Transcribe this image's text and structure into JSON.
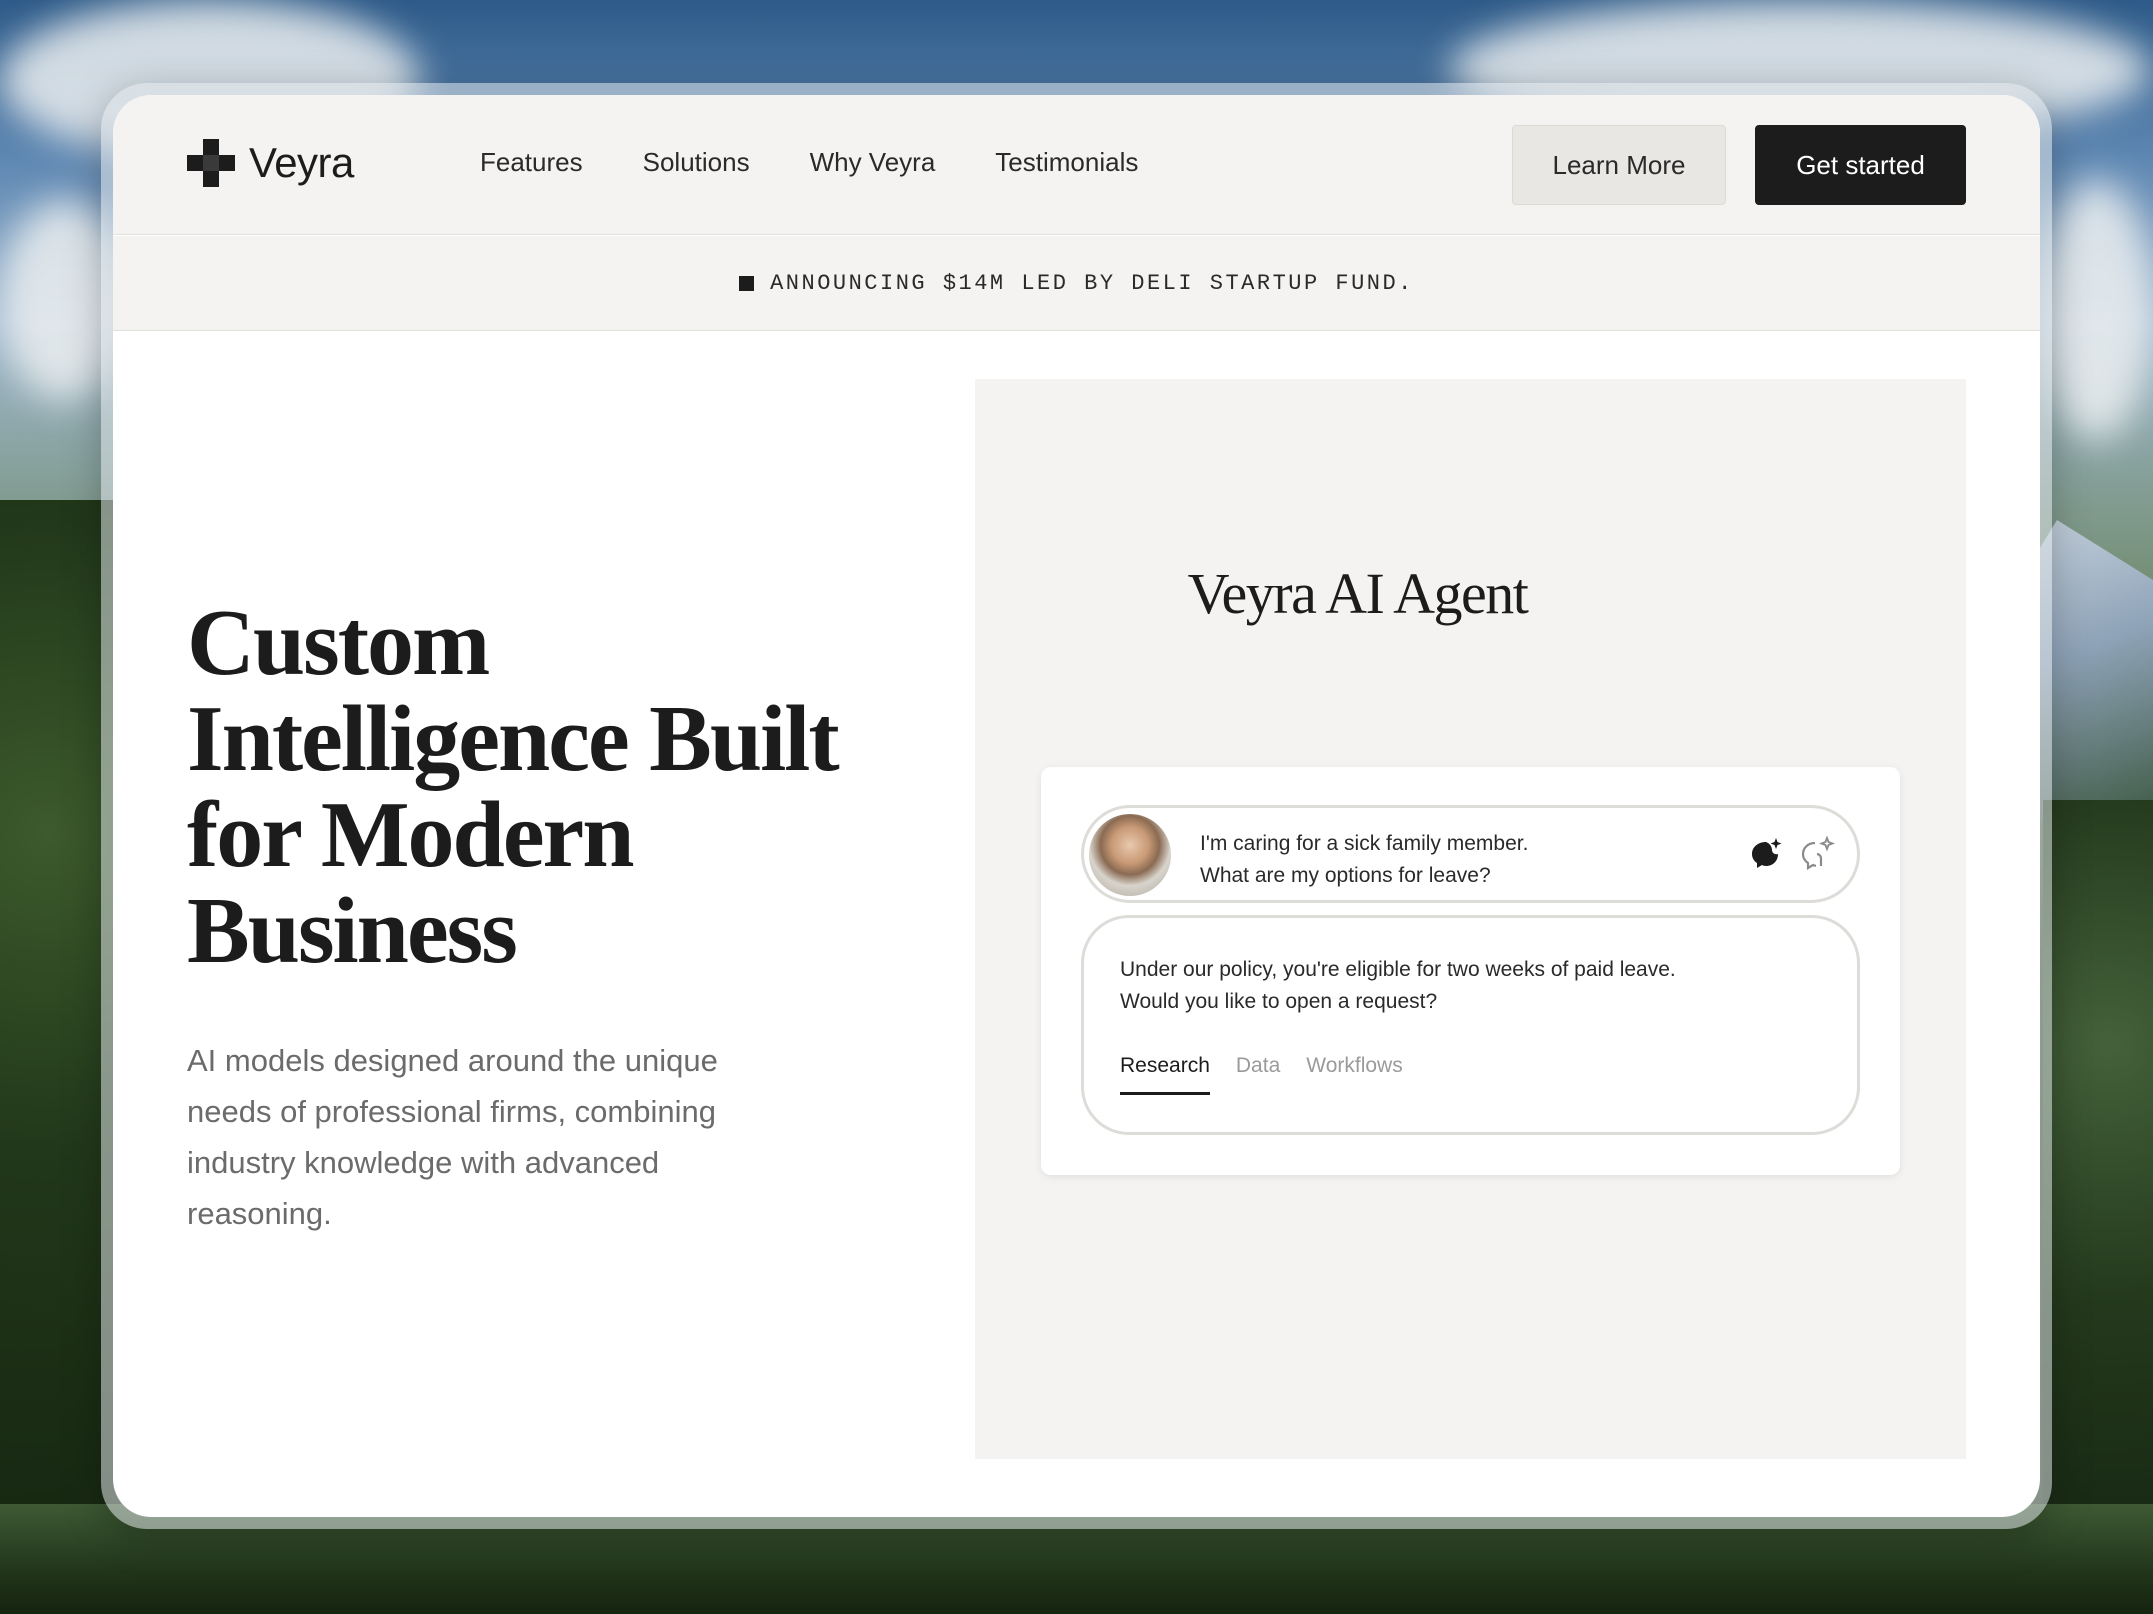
{
  "brand": {
    "name": "Veyra"
  },
  "nav": {
    "links": [
      "Features",
      "Solutions",
      "Why Veyra",
      "Testimonials"
    ],
    "learn_more": "Learn More",
    "get_started": "Get started"
  },
  "announcement": {
    "text": "ANNOUNCING $14M LED BY DELI STARTUP FUND."
  },
  "hero": {
    "title": "Custom Intelligence Built for Modern Business",
    "subtitle": "AI models designed around the unique needs of professional firms, combining industry knowledge with advanced reasoning."
  },
  "demo": {
    "title": "Veyra AI Agent",
    "query_line1": "I'm caring for a sick family member.",
    "query_line2": "What are my options for leave?",
    "answer_line1": "Under our policy, you're eligible for two weeks of paid leave.",
    "answer_line2": "Would you like to open a request?",
    "tabs": [
      "Research",
      "Data",
      "Workflows"
    ],
    "active_tab": "Research"
  },
  "icons": {
    "logo": "cross-pixel-logo-icon",
    "announce": "square-bullet-icon",
    "avatar": "user-avatar",
    "ai_solid": "sparkle-head-solid-icon",
    "ai_outline": "sparkle-head-outline-icon"
  },
  "colors": {
    "primary_dark": "#1c1c1c",
    "panel_bg": "#f4f3f1",
    "muted_text": "#6b6b6b",
    "button_light": "#e8e7e4"
  }
}
